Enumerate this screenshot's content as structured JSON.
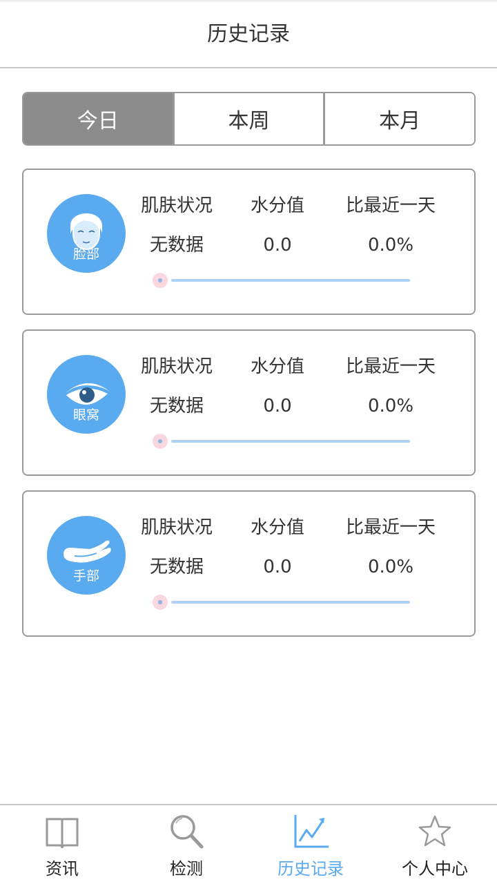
{
  "header": {
    "title": "历史记录"
  },
  "segments": {
    "today": "今日",
    "week": "本周",
    "month": "本月",
    "selected": "今日"
  },
  "columns": {
    "status": "肌肤状况",
    "moisture": "水分值",
    "compare": "比最近一天"
  },
  "cards": [
    {
      "area": "脸部",
      "icon": "face-icon",
      "status": "无数据",
      "moisture": "0.0",
      "compare": "0.0%",
      "slider_value": 0
    },
    {
      "area": "眼窝",
      "icon": "eye-icon",
      "status": "无数据",
      "moisture": "0.0",
      "compare": "0.0%",
      "slider_value": 0
    },
    {
      "area": "手部",
      "icon": "hand-icon",
      "status": "无数据",
      "moisture": "0.0",
      "compare": "0.0%",
      "slider_value": 0
    }
  ],
  "tabbar": {
    "items": [
      {
        "label": "资讯",
        "icon": "book-icon"
      },
      {
        "label": "检测",
        "icon": "magnifier-icon"
      },
      {
        "label": "历史记录",
        "icon": "chart-icon"
      },
      {
        "label": "个人中心",
        "icon": "star-icon"
      }
    ],
    "active": "历史记录"
  },
  "colors": {
    "accent": "#5aaaf0",
    "segment_active": "#8c8c8c",
    "slider_track": "#aed2f5",
    "slider_thumb": "#fad6df",
    "text": "#333333"
  }
}
